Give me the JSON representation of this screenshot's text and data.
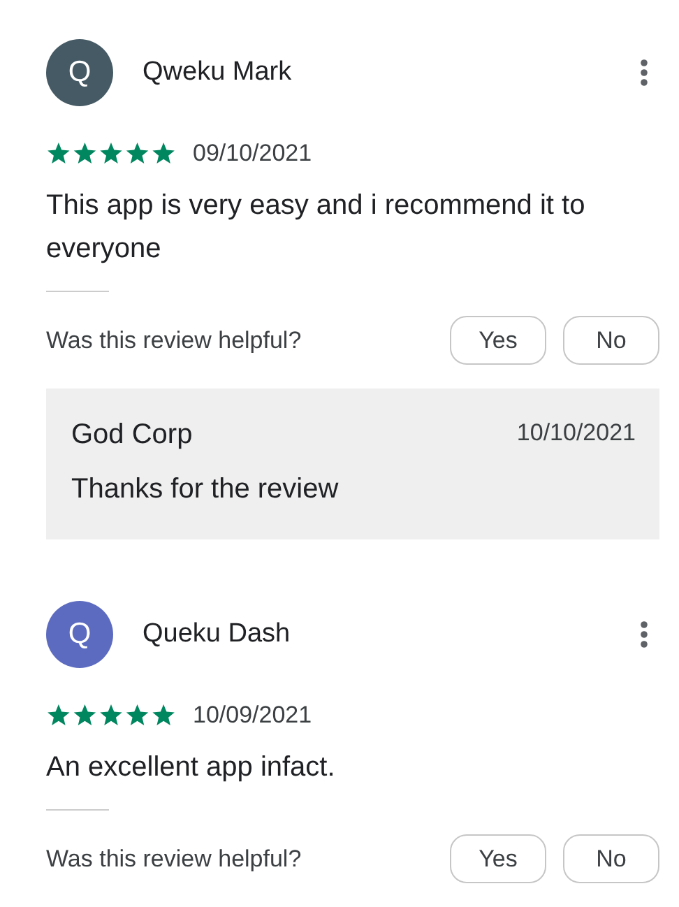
{
  "reviews": [
    {
      "author": "Qweku Mark",
      "initial": "Q",
      "color": "#455a64",
      "stars": 5,
      "date": "09/10/2021",
      "text": "This app is very easy and i recommend it to everyone",
      "helpful_prompt": "Was this review helpful?",
      "buttons": [
        "Yes",
        "No"
      ],
      "reply": {
        "author": "God Corp",
        "date": "10/10/2021",
        "text": "Thanks for the review"
      }
    },
    {
      "author": "Queku Dash",
      "initial": "Q",
      "color": "#5c6bc0",
      "stars": 5,
      "date": "10/09/2021",
      "text": "An excellent app infact.",
      "helpful_prompt": "Was this review helpful?",
      "buttons": [
        "Yes",
        "No"
      ]
    }
  ]
}
